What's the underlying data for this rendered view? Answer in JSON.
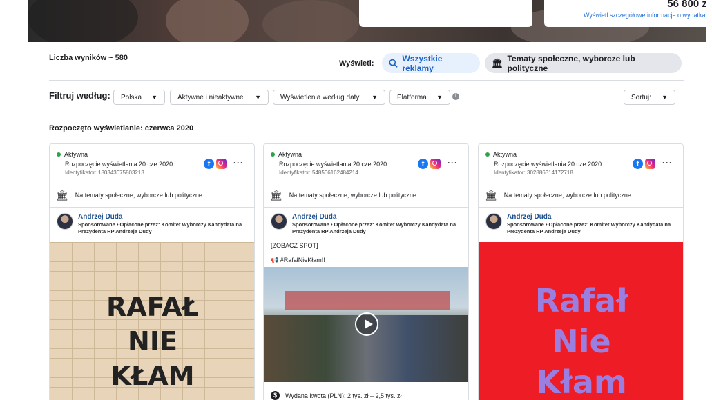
{
  "header": {
    "amount": "56 800 zł",
    "details_link": "Wyświetl szczegółowe informacje o wydatkach"
  },
  "results": {
    "count_label": "Liczba wyników ~ 580"
  },
  "view": {
    "label": "Wyświetl:",
    "all_ads": "Wszystkie reklamy",
    "political": "Tematy społeczne, wyborcze lub polityczne"
  },
  "filters": {
    "label": "Filtruj według:",
    "country": "Polska",
    "status": "Aktywne i nieaktywne",
    "impressions": "Wyświetlenia według daty",
    "platform": "Platforma",
    "sort": "Sortuj:"
  },
  "section_title": "Rozpoczęto wyświetlanie: czerwca 2020",
  "cards": [
    {
      "status": "Aktywna",
      "start": "Rozpoczęcie wyświetlania 20 cze 2020",
      "id": "Identyfikator: 180343075803213",
      "category": "Na tematy społeczne, wyborcze lub polityczne",
      "advertiser": "Andrzej Duda",
      "sponsor": "Sponsorowane • Opłacone przez: Komitet Wyborczy Kandydata na Prezydenta RP Andrzeja Dudy",
      "poster": [
        "RAFAŁ",
        "NIE",
        "KŁAM"
      ]
    },
    {
      "status": "Aktywna",
      "start": "Rozpoczęcie wyświetlania 20 cze 2020",
      "id": "Identyfikator: 548506162484214",
      "category": "Na tematy społeczne, wyborcze lub polityczne",
      "advertiser": "Andrzej Duda",
      "sponsor": "Sponsorowane • Opłacone przez: Komitet Wyborczy Kandydata na Prezydenta RP Andrzeja Dudy",
      "text1": "[ZOBACZ SPOT]",
      "text2": "📢 #RafałNieKłam!!",
      "spend": "Wydana kwota (PLN): 2 tys. zł – 2,5 tys. zł"
    },
    {
      "status": "Aktywna",
      "start": "Rozpoczęcie wyświetlania 20 cze 2020",
      "id": "Identyfikator: 302886314172718",
      "category": "Na tematy społeczne, wyborcze lub polityczne",
      "advertiser": "Andrzej Duda",
      "sponsor": "Sponsorowane • Opłacone przez: Komitet Wyborczy Kandydata na Prezydenta RP Andrzeja Dudy",
      "poster": [
        "Rafał",
        "Nie",
        "Kłam"
      ]
    }
  ],
  "colors": {
    "accent": "#1877f2",
    "active": "#31a24c",
    "poster_red": "#ee1c25"
  }
}
